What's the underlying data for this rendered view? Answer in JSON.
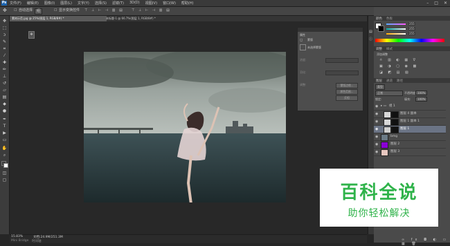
{
  "menubar": {
    "logo": "Ps",
    "menus": [
      "文件(F)",
      "编辑(E)",
      "图像(I)",
      "图层(L)",
      "文字(Y)",
      "选择(S)",
      "滤镜(T)",
      "3D(D)",
      "视图(V)",
      "窗口(W)",
      "帮助(H)"
    ],
    "minimize": "–",
    "maximize": "□",
    "close": "✕"
  },
  "options": {
    "tool_icon": "✥",
    "auto_select": "自动选择",
    "group": "组",
    "transform": "显示变换控件",
    "workspace": "基本功能"
  },
  "tabs": [
    {
      "label": "素材示范.jpg @ 25%(图层 1, RGB/8#) *",
      "active": true
    },
    {
      "label": "未标题-1 @ 66.7%(图层 1, RGB/8#) *",
      "active": false
    }
  ],
  "dialog": {
    "title": "属性",
    "subtitle": "蒙版",
    "mask_label": "未选择蒙版",
    "density_label": "浓度:",
    "feather_label": "羽化:",
    "refine_label": "调整:",
    "btn1": "蒙版边缘...",
    "btn2": "颜色范围...",
    "btn3": "反相"
  },
  "color_panel": {
    "tabs": [
      "颜色",
      "色板"
    ],
    "values": [
      "255",
      "255",
      "255"
    ],
    "colors": {
      "fg": "#ffffff",
      "bg": "#000000"
    }
  },
  "adjust_panel": {
    "tabs": [
      "调整",
      "样式"
    ],
    "title": "添加调整"
  },
  "layers_panel": {
    "tabs": [
      "图层",
      "通道",
      "路径"
    ],
    "kind": "类型",
    "blend": "正常",
    "opacity_label": "不透明度:",
    "opacity": "100%",
    "lock_label": "锁定:",
    "fill_label": "填充:",
    "fill": "100%",
    "layers": [
      {
        "name": "组 1",
        "thumb": "#3a3a3a",
        "type": "group",
        "selected": false
      },
      {
        "name": "图层 4 副本",
        "thumb": "#d8d8d8",
        "type": "layer",
        "selected": false
      },
      {
        "name": "图层 1 副本 1",
        "thumb": "#d8d8d8",
        "type": "layer",
        "selected": false
      },
      {
        "name": "图层 1",
        "thumb": "#cfcfcf",
        "type": "layer",
        "selected": true
      },
      {
        "name": "bmg",
        "thumb": "#6b7a86",
        "type": "layer",
        "selected": false
      },
      {
        "name": "图层 2",
        "thumb": "#8a00d6",
        "type": "layer",
        "selected": false
      },
      {
        "name": "图层 3",
        "thumb": "#e8c8c0",
        "type": "layer",
        "selected": false
      }
    ]
  },
  "status": {
    "zoom": "15.83%",
    "doc": "文档:24.9M/251.3M",
    "bridge_tabs": [
      "Mini Bridge",
      "时间轴"
    ]
  },
  "watermark": {
    "main": "百科全说",
    "sub": "助你轻松解决"
  }
}
